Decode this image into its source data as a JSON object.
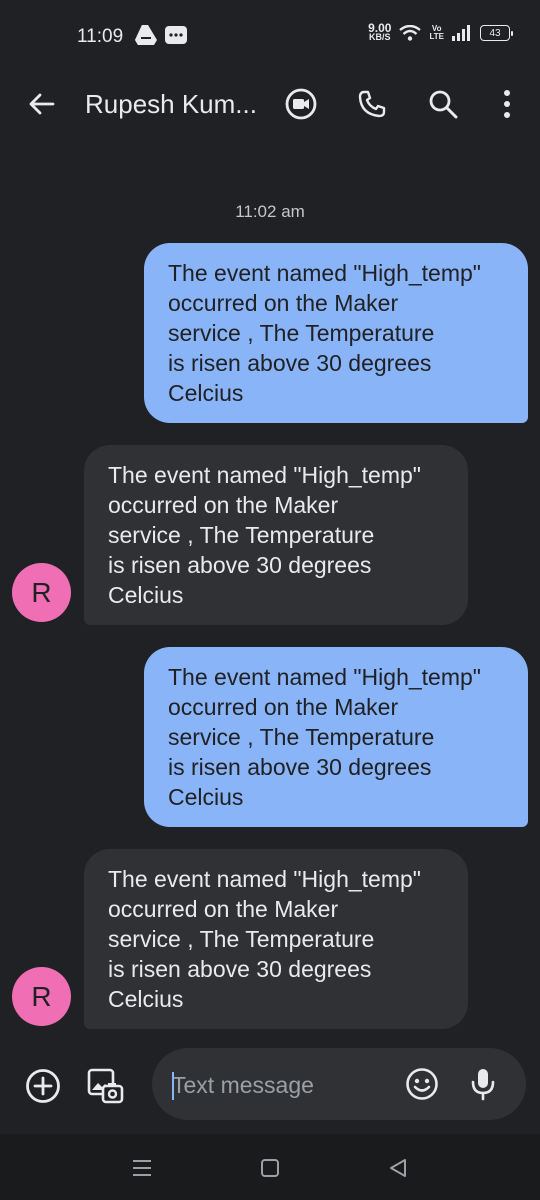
{
  "status_bar": {
    "time": "11:09",
    "net_speed_value": "9.00",
    "net_speed_unit": "KB/S",
    "volte_top": "Vo",
    "volte_bottom": "LTE",
    "battery": "43"
  },
  "header": {
    "contact_name": "Rupesh Kum...",
    "icons": [
      "back-arrow-icon",
      "video-call-icon",
      "phone-icon",
      "search-icon",
      "more-vert-icon"
    ]
  },
  "conversation": {
    "timestamp": "11:02 am",
    "messages": [
      {
        "direction": "outgoing",
        "lines": [
          "The event named \"High_temp\"",
          "occurred on the Maker",
          "service , The Temperature",
          "is risen above 30 degrees",
          "Celcius"
        ]
      },
      {
        "direction": "incoming",
        "avatar_letter": "R",
        "lines": [
          "The event named \"High_temp\"",
          "occurred on the Maker",
          "service , The Temperature",
          "is risen above 30 degrees",
          "Celcius"
        ]
      },
      {
        "direction": "outgoing",
        "lines": [
          "The event named \"High_temp\"",
          "occurred on the Maker",
          "service , The Temperature",
          "is risen above 30 degrees",
          "Celcius"
        ]
      },
      {
        "direction": "incoming",
        "avatar_letter": "R",
        "lines": [
          "The event named \"High_temp\"",
          "occurred on the Maker",
          "service , The Temperature",
          "is risen above 30 degrees",
          "Celcius"
        ]
      }
    ]
  },
  "compose": {
    "placeholder": "Text message",
    "icons": [
      "add-circle-icon",
      "gallery-icon",
      "emoji-icon",
      "mic-icon"
    ]
  },
  "colors": {
    "background": "#202124",
    "outgoing_bubble": "#8ab4f8",
    "incoming_bubble": "#303134",
    "avatar": "#f06fb4"
  }
}
